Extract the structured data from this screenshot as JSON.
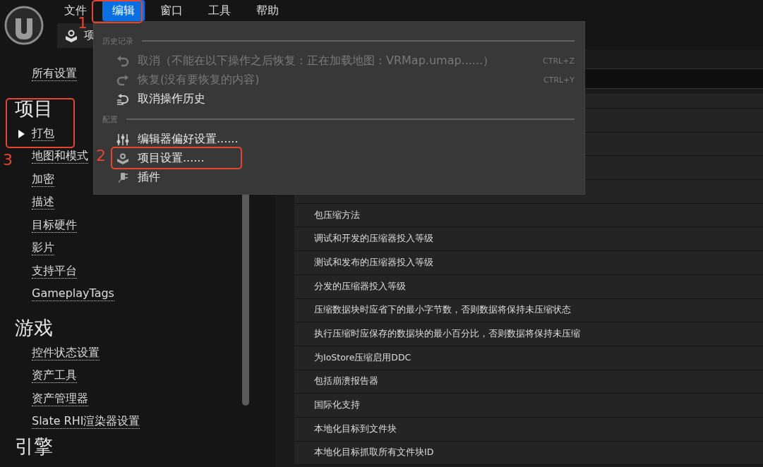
{
  "menubar": [
    {
      "label": "文件",
      "selected": false
    },
    {
      "label": "编辑",
      "selected": true
    },
    {
      "label": "窗口",
      "selected": false
    },
    {
      "label": "工具",
      "selected": false
    },
    {
      "label": "帮助",
      "selected": false
    }
  ],
  "tab": {
    "label": "项"
  },
  "sidebar": {
    "all_settings": "所有设置",
    "sections": [
      {
        "title": "项目",
        "items": [
          {
            "label": "打包",
            "selected": true
          },
          {
            "label": "地图和模式",
            "selected": false
          },
          {
            "label": "加密",
            "selected": false
          },
          {
            "label": "描述",
            "selected": false
          },
          {
            "label": "目标硬件",
            "selected": false
          },
          {
            "label": "影片",
            "selected": false
          },
          {
            "label": "支持平台",
            "selected": false
          },
          {
            "label": "GameplayTags",
            "selected": false
          }
        ]
      },
      {
        "title": "游戏",
        "items": [
          {
            "label": "控件状态设置",
            "selected": false
          },
          {
            "label": "资产工具",
            "selected": false
          },
          {
            "label": "资产管理器",
            "selected": false
          },
          {
            "label": "Slate RHI渲染器设置",
            "selected": false
          }
        ]
      },
      {
        "title": "引擎"
      }
    ]
  },
  "settings_rows": [
    "包压缩方法",
    "调试和开发的压缩器投入等级",
    "测试和发布的压缩器投入等级",
    "分发的压缩器投入等级",
    "压缩数据块时应省下的最小字节数，否则数据将保持未压缩状态",
    "执行压缩时应保存的数据块的最小百分比，否则数据将保持未压缩",
    "为IoStore压缩启用DDC",
    "包括崩溃报告器",
    "国际化支持",
    "本地化目标到文件块",
    "本地化目标抓取所有文件块ID"
  ],
  "edit_menu": {
    "sections": [
      {
        "heading": "历史记录",
        "items": [
          {
            "label": "取消（不能在以下操作之后恢复：正在加载地图：VRMap.umap......）",
            "shortcut": "CTRL+Z",
            "disabled": true
          },
          {
            "label": "恢复(没有要恢复的内容)",
            "shortcut": "CTRL+Y",
            "disabled": true
          },
          {
            "label": "取消操作历史",
            "disabled": false
          }
        ]
      },
      {
        "heading": "配置",
        "items": [
          {
            "label": "编辑器偏好设置......",
            "disabled": false
          },
          {
            "label": "项目设置......",
            "disabled": false
          },
          {
            "label": "插件",
            "disabled": false
          }
        ]
      }
    ]
  },
  "annotations": [
    {
      "label": "1"
    },
    {
      "label": "2"
    },
    {
      "label": "3"
    }
  ]
}
